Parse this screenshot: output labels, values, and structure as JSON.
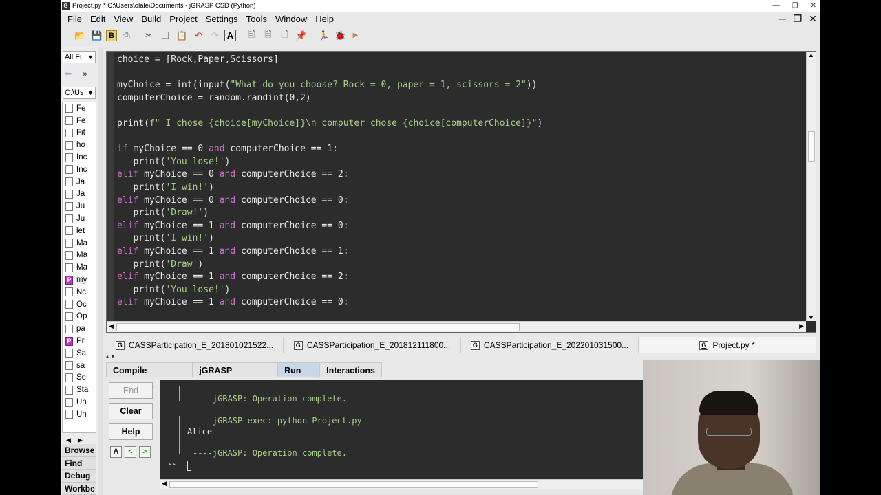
{
  "window": {
    "title": "Project.py * C:\\Users\\olale\\Documents - jGRASP CSD (Python)"
  },
  "menu": [
    "File",
    "Edit",
    "View",
    "Build",
    "Project",
    "Settings",
    "Tools",
    "Window",
    "Help"
  ],
  "toolbar_icons": [
    "open-icon",
    "save-icon",
    "bold-save-icon",
    "print-icon",
    "cut-icon",
    "copy-icon",
    "paste-icon",
    "undo-icon",
    "redo-icon",
    "font-icon",
    "page-icon",
    "page-icon",
    "page-icon",
    "pin-icon",
    "run-icon",
    "debug-bug-icon",
    "run-step-icon"
  ],
  "browse": {
    "filter": "All Fi",
    "directory": "C:\\Us",
    "files": [
      {
        "name": "Fe",
        "type": "file"
      },
      {
        "name": "Fe",
        "type": "file"
      },
      {
        "name": "Fit",
        "type": "file"
      },
      {
        "name": "ho",
        "type": "file"
      },
      {
        "name": "Inc",
        "type": "file"
      },
      {
        "name": "Inc",
        "type": "file"
      },
      {
        "name": "Ja",
        "type": "file"
      },
      {
        "name": "Ja",
        "type": "file"
      },
      {
        "name": "Ju",
        "type": "file"
      },
      {
        "name": "Ju",
        "type": "file"
      },
      {
        "name": "let",
        "type": "file"
      },
      {
        "name": "Ma",
        "type": "file"
      },
      {
        "name": "Ma",
        "type": "file"
      },
      {
        "name": "Ma",
        "type": "file"
      },
      {
        "name": "my",
        "type": "py"
      },
      {
        "name": "Nc",
        "type": "file"
      },
      {
        "name": "Oc",
        "type": "file"
      },
      {
        "name": "Op",
        "type": "file"
      },
      {
        "name": "pa",
        "type": "file"
      },
      {
        "name": "Pr",
        "type": "py"
      },
      {
        "name": "Sa",
        "type": "file"
      },
      {
        "name": "sa",
        "type": "file"
      },
      {
        "name": "Se",
        "type": "file"
      },
      {
        "name": "Sta",
        "type": "file"
      },
      {
        "name": "Un",
        "type": "file"
      },
      {
        "name": "Un",
        "type": "file"
      }
    ],
    "side_tabs": [
      "Browse",
      "Find",
      "Debug",
      "Workbe"
    ]
  },
  "code_lines": [
    [
      {
        "t": "choice = [Rock,Paper,Scissors]",
        "c": "txt"
      }
    ],
    [
      {
        "t": "",
        "c": "txt"
      }
    ],
    [
      {
        "t": "myChoice = int(input(",
        "c": "txt"
      },
      {
        "t": "\"What do you choose? Rock = 0, paper = 1, scissors = 2\"",
        "c": "str"
      },
      {
        "t": "))",
        "c": "txt"
      }
    ],
    [
      {
        "t": "computerChoice = random.randint(0,2)",
        "c": "txt"
      }
    ],
    [
      {
        "t": "",
        "c": "txt"
      }
    ],
    [
      {
        "t": "print(",
        "c": "txt"
      },
      {
        "t": "f\" I chose {choice[myChoice]}\\n computer chose {choice[computerChoice]}\"",
        "c": "str"
      },
      {
        "t": ")",
        "c": "txt"
      }
    ],
    [
      {
        "t": "",
        "c": "txt"
      }
    ],
    [
      {
        "t": "if",
        "c": "kw"
      },
      {
        "t": " myChoice == 0 ",
        "c": "txt"
      },
      {
        "t": "and",
        "c": "kw"
      },
      {
        "t": " computerChoice == 1:",
        "c": "txt"
      }
    ],
    [
      {
        "t": "   print(",
        "c": "txt"
      },
      {
        "t": "'You lose!'",
        "c": "str"
      },
      {
        "t": ")",
        "c": "txt"
      }
    ],
    [
      {
        "t": "elif",
        "c": "kw"
      },
      {
        "t": " myChoice == 0 ",
        "c": "txt"
      },
      {
        "t": "and",
        "c": "kw"
      },
      {
        "t": " computerChoice == 2:",
        "c": "txt"
      }
    ],
    [
      {
        "t": "   print(",
        "c": "txt"
      },
      {
        "t": "'I win!'",
        "c": "str"
      },
      {
        "t": ")",
        "c": "txt"
      }
    ],
    [
      {
        "t": "elif",
        "c": "kw"
      },
      {
        "t": " myChoice == 0 ",
        "c": "txt"
      },
      {
        "t": "and",
        "c": "kw"
      },
      {
        "t": " computerChoice == 0:",
        "c": "txt"
      }
    ],
    [
      {
        "t": "   print(",
        "c": "txt"
      },
      {
        "t": "'Draw!'",
        "c": "str"
      },
      {
        "t": ")",
        "c": "txt"
      }
    ],
    [
      {
        "t": "elif",
        "c": "kw"
      },
      {
        "t": " myChoice == 1 ",
        "c": "txt"
      },
      {
        "t": "and",
        "c": "kw"
      },
      {
        "t": " computerChoice == 0:",
        "c": "txt"
      }
    ],
    [
      {
        "t": "   print(",
        "c": "txt"
      },
      {
        "t": "'I win!'",
        "c": "str"
      },
      {
        "t": ")",
        "c": "txt"
      }
    ],
    [
      {
        "t": "elif",
        "c": "kw"
      },
      {
        "t": " myChoice == 1 ",
        "c": "txt"
      },
      {
        "t": "and",
        "c": "kw"
      },
      {
        "t": " computerChoice == 1:",
        "c": "txt"
      }
    ],
    [
      {
        "t": "   print(",
        "c": "txt"
      },
      {
        "t": "'Draw'",
        "c": "str"
      },
      {
        "t": ")",
        "c": "txt"
      }
    ],
    [
      {
        "t": "elif",
        "c": "kw"
      },
      {
        "t": " myChoice == 1 ",
        "c": "txt"
      },
      {
        "t": "and",
        "c": "kw"
      },
      {
        "t": " computerChoice == 2:",
        "c": "txt"
      }
    ],
    [
      {
        "t": "   print(",
        "c": "txt"
      },
      {
        "t": "'You lose!'",
        "c": "str"
      },
      {
        "t": ")",
        "c": "txt"
      }
    ],
    [
      {
        "t": "elif",
        "c": "kw"
      },
      {
        "t": " myChoice == 1 ",
        "c": "txt"
      },
      {
        "t": "and",
        "c": "kw"
      },
      {
        "t": " computerChoice == 0:",
        "c": "txt"
      }
    ]
  ],
  "doc_tabs": [
    {
      "label": "CASSParticipation_E_201801021522...",
      "active": false
    },
    {
      "label": "CASSParticipation_E_201812111800...",
      "active": false
    },
    {
      "label": "CASSParticipation_E_202201031500...",
      "active": false
    },
    {
      "label": "Project.py *",
      "active": true
    }
  ],
  "message_tabs": [
    {
      "label": "Compile Messages",
      "active": false
    },
    {
      "label": "jGRASP Messages",
      "active": false
    },
    {
      "label": "Run I/O",
      "active": true
    },
    {
      "label": "Interactions",
      "active": false
    }
  ],
  "io_buttons": {
    "end": "End",
    "clear": "Clear",
    "help": "Help"
  },
  "io_small_buttons": [
    "A",
    "<",
    ">"
  ],
  "console": {
    "line1": "----jGRASP: Operation complete.",
    "line2": "----jGRASP exec: python Project.py",
    "line3": "Alice",
    "line4": "----jGRASP: Operation complete.",
    "prompt": "▸▸"
  },
  "colors": {
    "keyword": "#d070d0",
    "string": "#a8d08a",
    "editor_bg": "#2c2c2c",
    "active_tab": "#c8d8e8"
  }
}
